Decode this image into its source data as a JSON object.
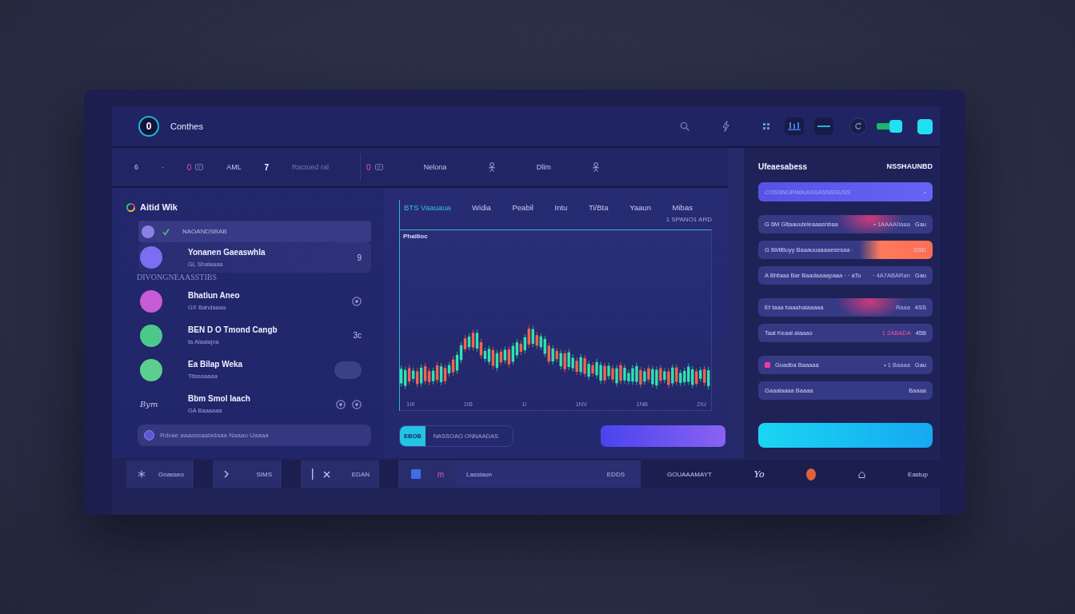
{
  "header": {
    "logo": "0",
    "title": "Conthes",
    "toggle": {
      "on": true
    }
  },
  "toolbar": {
    "groups": [
      {
        "items": [
          {
            "kind": "text",
            "text": "6"
          },
          {
            "kind": "text",
            "text": "·"
          },
          {
            "kind": "accent",
            "text": "0"
          },
          {
            "kind": "text",
            "text": "AML"
          },
          {
            "kind": "strong",
            "text": "7"
          },
          {
            "kind": "muted",
            "text": "Ractoed ral"
          }
        ]
      },
      {
        "items": [
          {
            "kind": "accent",
            "text": "0"
          },
          {
            "kind": "text",
            "text": "Nelona"
          },
          {
            "kind": "person"
          },
          {
            "kind": "text",
            "text": "Dlim"
          },
          {
            "kind": "person"
          }
        ]
      }
    ]
  },
  "sidebar": {
    "title": "Aitid Wik",
    "items": [
      {
        "kind": "pinned",
        "label": "NAOANDSBAB",
        "selected": true
      },
      {
        "kind": "contact",
        "name": "Yonanen Gaeaswhla",
        "detail": "GL Shalaaaa",
        "color": "#7c6ef0",
        "trailing": {
          "kind": "text",
          "text": "9"
        },
        "selected": true
      },
      {
        "kind": "heading",
        "label": "DIVONGNEAASSTIBS"
      },
      {
        "kind": "contact",
        "name": "Bhatiun Aneo",
        "detail": "GX Bahdaaaa",
        "color": "#c75bd6",
        "trailing": {
          "kind": "ring"
        },
        "selected": false
      },
      {
        "kind": "contact",
        "name": "BEN D O Tmond Cangb",
        "detail": "ta Alaalajna",
        "color": "#4cc98a",
        "trailing": {
          "kind": "text",
          "text": "3c"
        },
        "selected": false
      },
      {
        "kind": "contact",
        "name": "Ea Bilap Weka",
        "detail": "Tifasaaaaa",
        "color": "#5ccf8e",
        "trailing": {
          "kind": "pill"
        },
        "selected": false
      },
      {
        "kind": "contact",
        "name": "Bbm Smol Iaach",
        "detail": "GA Baaaaaa",
        "avatar_text": "Bym",
        "trailing": {
          "kind": "rings"
        },
        "selected": false
      }
    ],
    "input": {
      "placeholder": "Rdvae aaaassaaladaaa Naaao Uaaaa"
    }
  },
  "chart": {
    "tabs": [
      {
        "label": "BTS Vaauaua",
        "selected": true
      },
      {
        "label": "Widia",
        "selected": false
      },
      {
        "label": "Peabil",
        "selected": false
      },
      {
        "label": "Intu",
        "selected": false
      },
      {
        "label": "Ti/Bta",
        "selected": false
      },
      {
        "label": "Yaaun",
        "selected": false
      },
      {
        "label": "Mibas",
        "selected": false
      }
    ],
    "note": "1 SPANO1 ARD",
    "title": "Phallioc",
    "axis_labels": [
      "1III",
      "1IB",
      "1I",
      "1NV",
      "1NB",
      "2IU"
    ],
    "segments": [
      {
        "label": "EBOB",
        "selected": true
      },
      {
        "label": "NASSOAO ONNAADAS",
        "selected": false
      }
    ]
  },
  "orders": {
    "title": "Ufeaesabess",
    "code": "NSSHAUNBD",
    "sections": [
      {
        "rows": [
          {
            "kind": "primary",
            "label": "COSSNGRWAIASSASNSSUSS",
            "amount": "•"
          }
        ]
      },
      {
        "rows": [
          {
            "kind": "glow",
            "label": "G 6M Gltaauuteieaaasnbaa",
            "value": "• 1AAAAIIaaa",
            "amount": "Gau"
          },
          {
            "kind": "hot",
            "label": "G BMiBuyy Baaauuaaaaesesaa ·",
            "amount": "GSD"
          },
          {
            "kind": "plain",
            "label": "A Bhfaaa Bar Baadaaaapaaa · · aTo",
            "value": "· 4A7ABARan",
            "amount": "Gau"
          }
        ]
      },
      {
        "rows": [
          {
            "kind": "glow",
            "label": "Ef taaa baaahaiaaaaa",
            "value": "Raaa",
            "amount": "4SS"
          },
          {
            "kind": "alert",
            "label": "Taal Keaal aiaaao",
            "value": "1 2ABADA",
            "amount": "45B"
          }
        ]
      },
      {
        "rows": [
          {
            "kind": "tagged",
            "label": "Goadba Baaaaa",
            "value": "• 1 Baaaa",
            "amount": "Gau"
          },
          {
            "kind": "plain",
            "label": "Gaaalaaaa Baaaa",
            "amount": "Baaaa"
          }
        ]
      }
    ]
  },
  "bottom_bar": {
    "tabs": [
      {
        "kind": "asterisk",
        "label": "Gnasseo"
      },
      {
        "kind": "chevron",
        "label": "SIMS"
      },
      {
        "kind": "close",
        "label": "EDAN"
      },
      {
        "kind": "square",
        "label": "m"
      }
    ],
    "panel": {
      "title": "Lassiaun",
      "code": "EDDS"
    },
    "status": [
      {
        "kind": "text",
        "text": "GOUAAAMAYT"
      },
      {
        "kind": "logo",
        "text": "Yo"
      },
      {
        "kind": "dot",
        "color": "#e2613c"
      },
      {
        "kind": "home"
      },
      {
        "kind": "text",
        "text": "Eastup"
      }
    ]
  }
}
